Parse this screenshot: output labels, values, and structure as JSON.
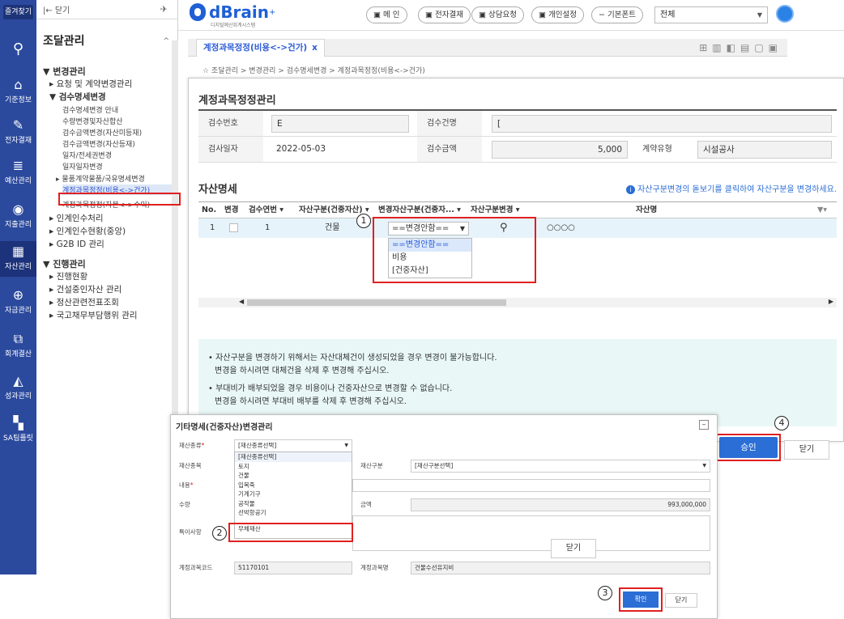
{
  "iconbar": {
    "favorites": "즐겨찾기",
    "items": [
      {
        "icon": "home-icon",
        "label": "기준정보",
        "glyph": "⌂"
      },
      {
        "icon": "pen-icon",
        "label": "전자결재",
        "glyph": "✎"
      },
      {
        "icon": "budget-icon",
        "label": "예산관리",
        "glyph": "≣"
      },
      {
        "icon": "receipt-icon",
        "label": "지출관리",
        "glyph": "◉"
      },
      {
        "icon": "asset-icon",
        "label": "자산관리",
        "glyph": "▦"
      },
      {
        "icon": "fund-icon",
        "label": "자금관리",
        "glyph": "⊕"
      },
      {
        "icon": "accounting-icon",
        "label": "회계결산",
        "glyph": "⧉"
      },
      {
        "icon": "chart-icon",
        "label": "성과관리",
        "glyph": "◭"
      },
      {
        "icon": "sa-icon",
        "label": "SA팀플릿",
        "glyph": "▚"
      }
    ]
  },
  "tree": {
    "close": "|← 닫기",
    "title": "조달관리",
    "items": [
      {
        "text": "▼ 변경관리",
        "level": 1
      },
      {
        "text": "▸ 요청 및 계약변경관리",
        "level": 2
      },
      {
        "text": "▼ 검수명세변경",
        "level": 2
      },
      {
        "text": "검수명세변경 안내",
        "level": 3
      },
      {
        "text": "수량변경및자산합산",
        "level": 3
      },
      {
        "text": "검수금액변경(자산미등재)",
        "level": 3
      },
      {
        "text": "검수금액변경(자산등재)",
        "level": 3
      },
      {
        "text": "일자/전세권변경",
        "level": 3
      },
      {
        "text": "일자일자변경",
        "level": 3
      },
      {
        "text": "▸ 물품계약물품/국유명세변경",
        "level": 3
      },
      {
        "text": "계정과목정정(비용<->건가)",
        "level": 3,
        "selected": true
      },
      {
        "text": "계정과목정정(자본<->수익)",
        "level": 3
      },
      {
        "text": "▸ 인계인수처리",
        "level": 2
      },
      {
        "text": "▸ 인계인수현황(중앙)",
        "level": 2
      },
      {
        "text": "▸ G2B ID 관리",
        "level": 2
      },
      {
        "text": "▼ 진행관리",
        "level": 1
      },
      {
        "text": "▸ 진행현황",
        "level": 2
      },
      {
        "text": "▸ 건설중인자산 관리",
        "level": 2
      },
      {
        "text": "▸ 정산관련전표조회",
        "level": 2
      },
      {
        "text": "▸ 국고채무부담행위 관리",
        "level": 2
      }
    ]
  },
  "header": {
    "brand": "dBrain",
    "brand_sup": "+",
    "brand_sub": "디지털예산회계시스템",
    "buttons": [
      "메 인",
      "전자결재",
      "상담요청",
      "개인설정",
      "−  기본폰트",
      "+"
    ],
    "font_select": "전체"
  },
  "tab": {
    "label": "계정과목정정(비용<->건가)",
    "close": "x"
  },
  "breadcrumb": "☆ 조달관리 > 변경관리 > 검수명세변경 > 계정과목정정(비용<->건가)",
  "main": {
    "title": "계정과목정정관리",
    "fields": {
      "inspection_no_label": "검수번호",
      "inspection_no": "E",
      "inspection_name_label": "검수건명",
      "inspection_name": "[",
      "inspection_date_label": "검사일자",
      "inspection_date": "2022-05-03",
      "inspection_amount_label": "검수금액",
      "inspection_amount": "5,000",
      "contract_type_label": "계약유형",
      "contract_type": "시설공사"
    },
    "asset_section_title": "자산명세",
    "asset_note": "자산구분변경의 돋보기를 클릭하여 자산구분을 변경하세요.",
    "grid": {
      "headers": [
        "No.",
        "변경",
        "검수연번 ▾",
        "자산구분(건중자산) ▾",
        "변경자산구분(건중자... ▾",
        "자산구분변경 ▾",
        "자산명",
        "▼▾"
      ],
      "row": {
        "no": "1",
        "serial": "1",
        "asset_type": "건물",
        "select_value": "==변경안함==",
        "asset_name": "○○○○"
      },
      "dropdown_options": [
        "==변경안함==",
        "비용",
        "[건중자산]"
      ]
    },
    "notice": [
      "• 자산구분을 변경하기 위해서는 자산대체건이 생성되었을 경우 변경이 불가능합니다.",
      "  변경을 하시려면 대체건을 삭제 후 변경해 주십시오.",
      "• 부대비가 배부되었을 경우 비용이나 건중자산으로 변경할 수 없습니다.",
      "  변경을 하시려면 부대비 배부를 삭제 후 변경해 주십시오."
    ],
    "approve": "승인",
    "close": "닫기"
  },
  "dialog2": {
    "title": "기타명세(건중자산)변경관리",
    "min": "−",
    "labels": {
      "type": "재산종류",
      "name": "재산종목",
      "content": "내용",
      "qty": "수량",
      "special": "특이사항",
      "acct_code": "계정과목코드",
      "class": "재산구분",
      "amount": "금액",
      "acct_name": "계정과목명"
    },
    "type_select": "[재산종류선택]",
    "class_select": "[재산구분선택]",
    "amount": "993,000,000",
    "acct_code": "51170101",
    "acct_name": "건물수선유지비",
    "list": [
      "[재산종류선택]",
      "토지",
      "건물",
      "입목죽",
      "기계기구",
      "공작물",
      "선박항공기",
      "무체재산"
    ],
    "confirm": "확인",
    "close": "닫기",
    "close_outer": "닫기"
  },
  "markers": [
    "1",
    "2",
    "3",
    "4"
  ],
  "colors": {
    "accent": "#2b6ed6",
    "nav": "#2b4a9e",
    "highlight": "#e02020"
  }
}
